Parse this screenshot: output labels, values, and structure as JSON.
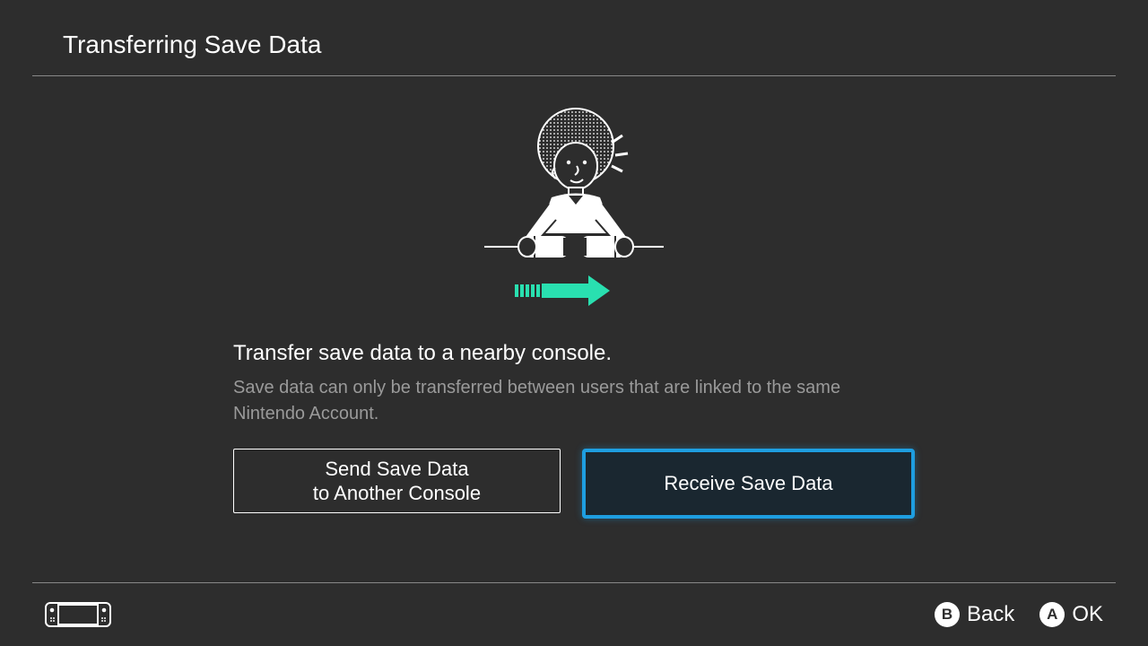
{
  "header": {
    "title": "Transferring Save Data"
  },
  "main": {
    "headline": "Transfer save data to a nearby console.",
    "subtext": "Save data can only be transferred between users that are linked to the same Nintendo Account."
  },
  "buttons": {
    "send": "Send Save Data\nto Another Console",
    "receive": "Receive Save Data"
  },
  "footer": {
    "back_key": "B",
    "back_label": "Back",
    "ok_key": "A",
    "ok_label": "OK"
  },
  "colors": {
    "accent_teal": "#29e0b0",
    "highlight_blue": "#1e9ee0"
  }
}
